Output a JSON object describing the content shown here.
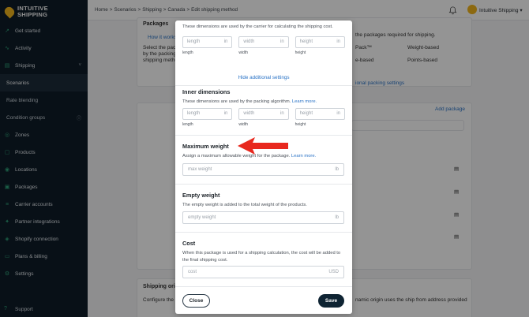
{
  "app": {
    "logo_line1": "INTUITIVE",
    "logo_line2": "SHIPPING"
  },
  "sidebar": {
    "items": [
      {
        "label": "Get started",
        "icon": "rocket-icon"
      },
      {
        "label": "Activity",
        "icon": "activity-icon"
      },
      {
        "label": "Shipping",
        "icon": "truck-icon"
      },
      {
        "label": "Scenarios",
        "sub": true
      },
      {
        "label": "Rate blending",
        "sub": true
      },
      {
        "label": "Condition groups",
        "sub": true
      },
      {
        "label": "Zones",
        "icon": "zones-icon"
      },
      {
        "label": "Products",
        "icon": "products-icon"
      },
      {
        "label": "Locations",
        "icon": "locations-icon"
      },
      {
        "label": "Packages",
        "icon": "packages-icon"
      },
      {
        "label": "Carrier accounts",
        "icon": "carrier-icon"
      },
      {
        "label": "Partner integrations",
        "icon": "partner-icon"
      },
      {
        "label": "Shopify connection",
        "icon": "shopify-icon"
      },
      {
        "label": "Plans & billing",
        "icon": "billing-icon"
      },
      {
        "label": "Settings",
        "icon": "settings-icon"
      }
    ],
    "support": "Support"
  },
  "topbar": {
    "breadcrumb": [
      "Home",
      ">",
      "Scenarios",
      ">",
      "Shipping",
      ">",
      "Canada",
      ">",
      "Edit shipping method"
    ],
    "user": "Intuitive Shipping"
  },
  "background": {
    "packages_title": "Packages",
    "how_it_works": "How it works",
    "select_text_1": "Select the packa",
    "select_text_2": "by the packing",
    "select_text_3": "shipping metho",
    "right_text": "the packages required for shipping.",
    "opt_pack": "Pack™",
    "opt_weight": "Weight-based",
    "opt_e_based": "e-based",
    "opt_points": "Points-based",
    "optional_link": "ional packing settings",
    "add_package": "Add package",
    "shipping_origin": "Shipping origi",
    "configure": "Configure the c",
    "dynamic_text": "namic origin uses the ship from address provided"
  },
  "modal": {
    "intro": "These dimensions are used by the carrier for calculating the shipping cost.",
    "outer": [
      {
        "placeholder": "length",
        "unit": "in",
        "label": "length"
      },
      {
        "placeholder": "width",
        "unit": "in",
        "label": "width"
      },
      {
        "placeholder": "height",
        "unit": "in",
        "label": "height"
      }
    ],
    "hide_settings": "Hide additional settings",
    "inner_title": "Inner dimensions",
    "inner_desc": "These dimensions are used by the packing algorithm.",
    "learn_more": "Learn more.",
    "inner": [
      {
        "placeholder": "length",
        "unit": "in",
        "label": "length"
      },
      {
        "placeholder": "width",
        "unit": "in",
        "label": "width"
      },
      {
        "placeholder": "height",
        "unit": "in",
        "label": "height"
      }
    ],
    "max_title": "Maximum weight",
    "max_desc": "Assign a maximum allowable weight for the package.",
    "max_placeholder": "max weight",
    "max_unit": "lb",
    "empty_title": "Empty weight",
    "empty_desc": "The empty weight is added to the total weight of the products.",
    "empty_placeholder": "empty weight",
    "empty_unit": "lb",
    "cost_title": "Cost",
    "cost_desc": "When this package is used for a shipping calculation, the cost will be added to the final shipping cost.",
    "cost_placeholder": "cost",
    "cost_unit": "USD",
    "close": "Close",
    "save": "Save"
  },
  "colors": {
    "accent": "#2a73c6",
    "save_bg": "#0f2433",
    "arrow": "#e8281e",
    "sidebar_bg": "#0f1c28"
  }
}
